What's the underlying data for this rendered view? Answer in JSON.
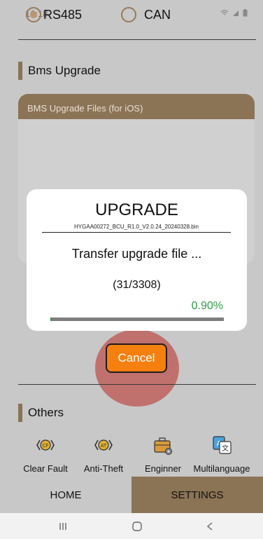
{
  "status_bar": {
    "time": "16:18",
    "protocols": [
      {
        "label": "RS485",
        "selected": true
      },
      {
        "label": "CAN",
        "selected": false
      }
    ],
    "icons": [
      "wifi-icon",
      "signal-icon",
      "battery-icon"
    ]
  },
  "bms_upgrade": {
    "section_title": "Bms Upgrade",
    "card_header": "BMS Upgrade Files (for iOS)"
  },
  "modal": {
    "title": "UPGRADE",
    "filename": "HYGAA00272_BCU_R1.0_V2.0.24_20240328.bin",
    "status": "Transfer upgrade file ...",
    "count": "(31/3308)",
    "percent": "0.90%",
    "progress_fraction": 0.009,
    "cancel_label": "Cancel"
  },
  "others": {
    "section_title": "Others",
    "tools": [
      {
        "label": "Clear Fault",
        "icon": "clear-fault-icon"
      },
      {
        "label": "Anti-Theft",
        "icon": "anti-theft-icon"
      },
      {
        "label": "Enginner",
        "icon": "engineer-toolbox-icon"
      },
      {
        "label": "Multilanguage",
        "icon": "translate-icon"
      }
    ]
  },
  "bottom_nav": {
    "tabs": [
      {
        "label": "HOME",
        "active": false
      },
      {
        "label": "SETTINGS",
        "active": true
      }
    ]
  },
  "system_nav": {
    "buttons": [
      "recents-icon",
      "home-icon",
      "back-icon"
    ]
  },
  "colors": {
    "accent_brown": "#8b7355",
    "cancel_orange": "#f57f0f",
    "progress_green": "#2e9d47",
    "overlay_gray": "#c8c8c8"
  }
}
